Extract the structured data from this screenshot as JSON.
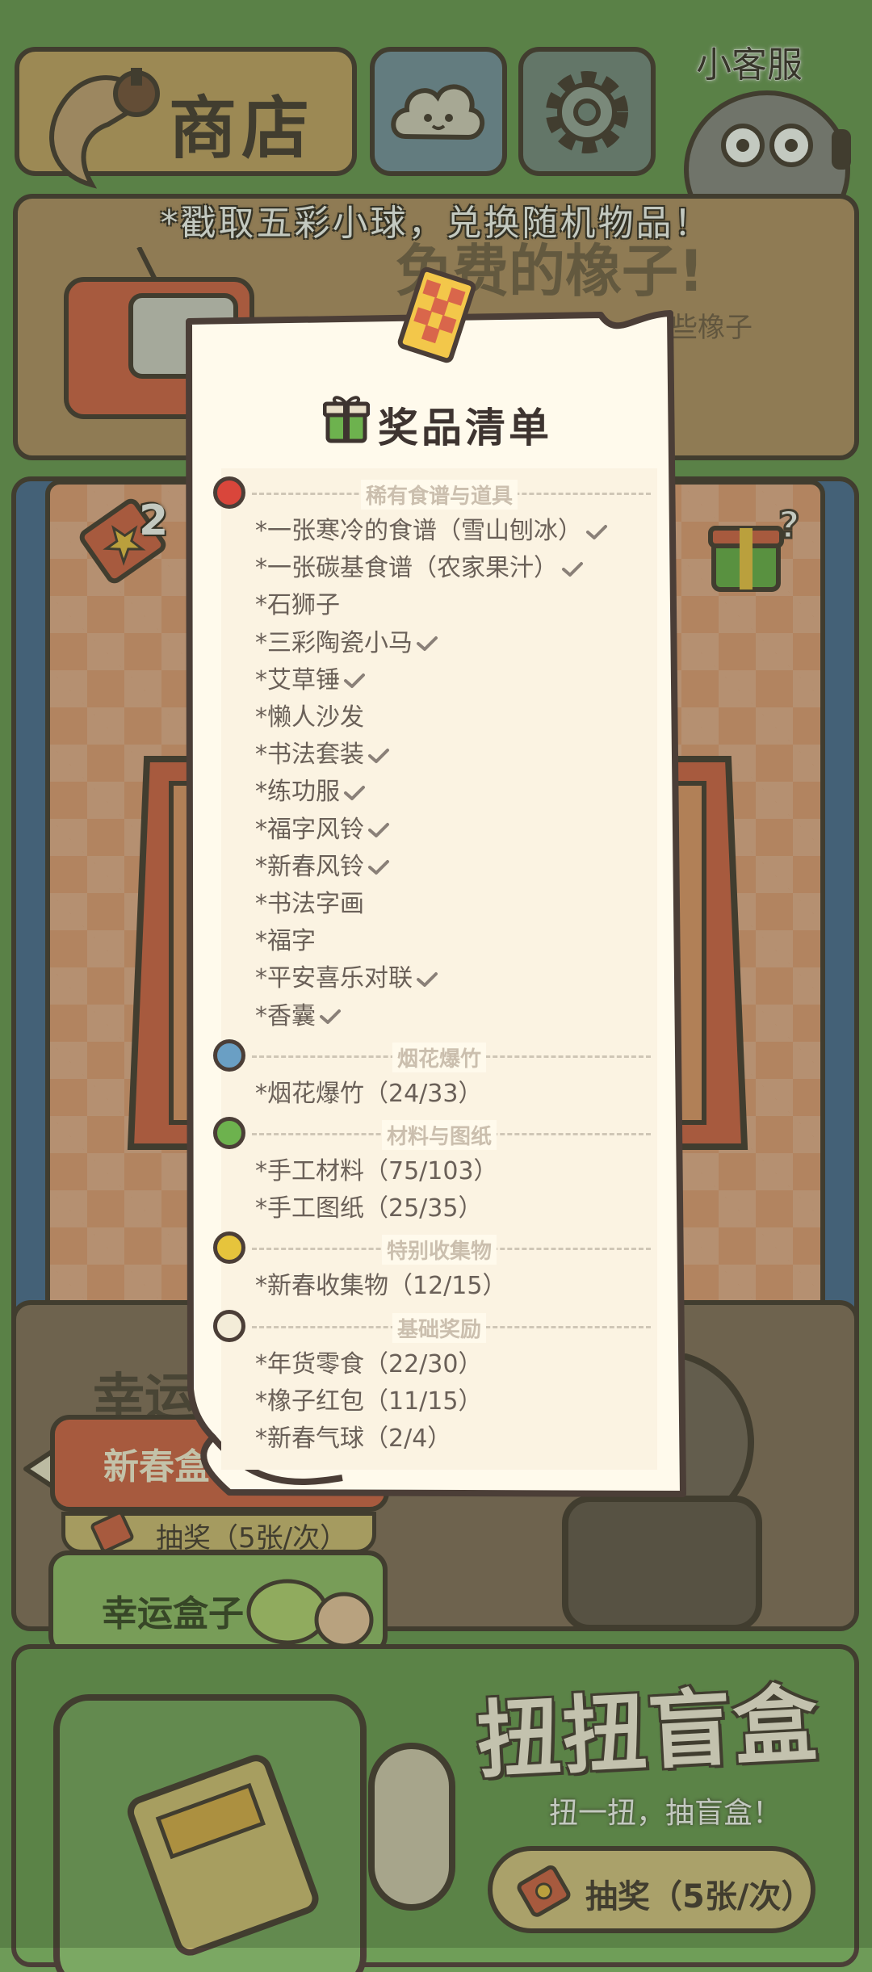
{
  "header": {
    "shop_label": "商店",
    "support_label": "小客服"
  },
  "banner": {
    "title": "免费的橡子!",
    "subtitle": "些橡子"
  },
  "hint": "*戳取五彩小球，兑换随机物品！",
  "machine": {
    "ticket_count": "2"
  },
  "lucky": {
    "title": "幸运",
    "newyear_box_label": "新春盒",
    "draw_label": "抽奖（5张/次）",
    "lucky_box_label": "幸运盒子"
  },
  "gacha": {
    "title": "扭扭盲盒",
    "subtitle": "扭一扭，抽盲盒！",
    "draw_label": "抽奖（5张/次）"
  },
  "prize_list": {
    "title": "奖品清单",
    "sections": [
      {
        "label": "稀有食谱与道具",
        "color": "#d9463b",
        "items": [
          {
            "text": "*一张寒冷的食谱（雪山刨冰）",
            "checked": true
          },
          {
            "text": "*一张碳基食谱（农家果汁）",
            "checked": true
          },
          {
            "text": "*石狮子",
            "checked": false
          },
          {
            "text": "*三彩陶瓷小马",
            "checked": true
          },
          {
            "text": "*艾草锤",
            "checked": true
          },
          {
            "text": "*懒人沙发",
            "checked": false
          },
          {
            "text": "*书法套装",
            "checked": true
          },
          {
            "text": "*练功服",
            "checked": true
          },
          {
            "text": "*福字风铃",
            "checked": true
          },
          {
            "text": "*新春风铃",
            "checked": true
          },
          {
            "text": "*书法字画",
            "checked": false
          },
          {
            "text": "*福字",
            "checked": false
          },
          {
            "text": "*平安喜乐对联",
            "checked": true
          },
          {
            "text": "*香囊",
            "checked": true
          }
        ]
      },
      {
        "label": "烟花爆竹",
        "color": "#6a9fc4",
        "items": [
          {
            "text": "*烟花爆竹（24/33）",
            "checked": false
          }
        ]
      },
      {
        "label": "材料与图纸",
        "color": "#6db24e",
        "items": [
          {
            "text": "*手工材料（75/103）",
            "checked": false
          },
          {
            "text": "*手工图纸（25/35）",
            "checked": false
          }
        ]
      },
      {
        "label": "特别收集物",
        "color": "#e6c43c",
        "items": [
          {
            "text": "*新春收集物（12/15）",
            "checked": false
          }
        ]
      },
      {
        "label": "基础奖励",
        "color": "#f3ecd8",
        "items": [
          {
            "text": "*年货零食（22/30）",
            "checked": false
          },
          {
            "text": "*橡子红包（11/15）",
            "checked": false
          },
          {
            "text": "*新春气球（2/4）",
            "checked": false
          }
        ]
      }
    ]
  }
}
